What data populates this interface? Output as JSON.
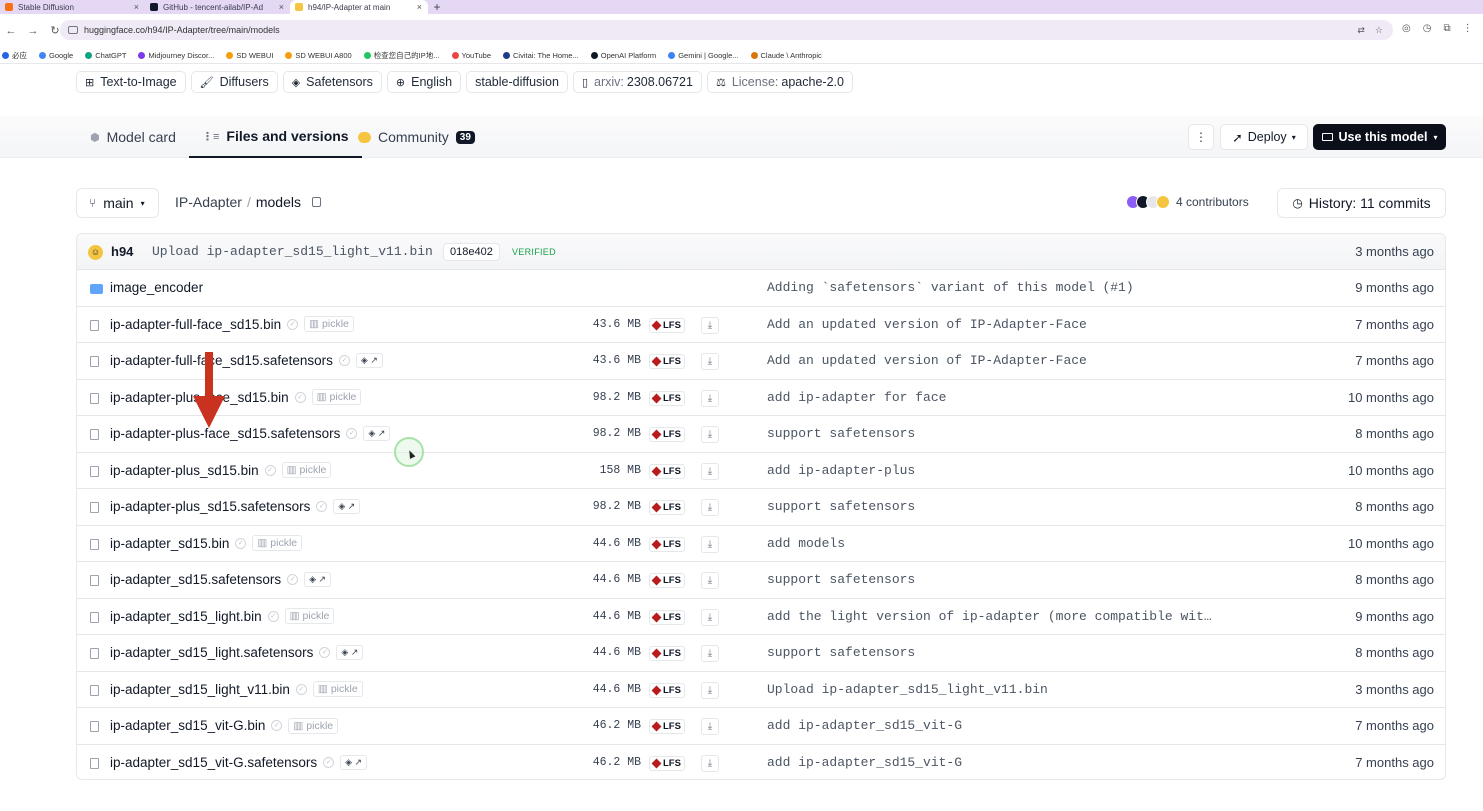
{
  "browser": {
    "tabs": [
      {
        "title": "Stable Diffusion",
        "icon_color": "#f97316"
      },
      {
        "title": "GitHub - tencent-ailab/IP-Ad",
        "icon_color": "#111827"
      },
      {
        "title": "h94/IP-Adapter at main",
        "icon_color": "#f5c542"
      }
    ],
    "new_tab": "+",
    "close_glyph": "×",
    "url": "huggingface.co/h94/IP-Adapter/tree/main/models",
    "bookmarks": [
      "必应",
      "Google",
      "ChatGPT",
      "Midjourney Discor...",
      "SD WEBUI",
      "SD WEBUI A800",
      "检查您自己的IP地...",
      "YouTube",
      "Civitai: The Home...",
      "OpenAI Platform",
      "Gemini | Google...",
      "Claude \\ Anthropic"
    ]
  },
  "tags": [
    {
      "icon": "text-to-image-icon",
      "glyph": "⊞",
      "label": "Text-to-Image"
    },
    {
      "icon": "diffusers-icon",
      "glyph": "🖌",
      "label": "Diffusers"
    },
    {
      "icon": "safetensors-icon",
      "glyph": "◈",
      "label": "Safetensors"
    },
    {
      "icon": "globe-icon",
      "glyph": "⊕",
      "label": "English"
    },
    {
      "icon": "",
      "glyph": "",
      "label": "stable-diffusion"
    },
    {
      "icon": "paper-icon",
      "glyph": "▯",
      "prefix": "arxiv:",
      "label": "2308.06721"
    },
    {
      "icon": "scale-icon",
      "glyph": "⚖",
      "prefix": "License:",
      "label": "apache-2.0"
    }
  ],
  "model_tabs": {
    "model_card": "Model card",
    "files": "Files and versions",
    "community": "Community",
    "community_count": "39"
  },
  "actions": {
    "kebab": "⋮",
    "deploy": "Deploy",
    "use_model": "Use this model"
  },
  "repo": {
    "branch": "main",
    "path_root": "IP-Adapter",
    "path_sep": "/",
    "path_dir": "models",
    "contributors": "4 contributors",
    "history": "History: 11 commits"
  },
  "last_commit": {
    "author": "h94",
    "message": "Upload ip-adapter_sd15_light_v11.bin",
    "hash": "018e402",
    "verified": "VERIFIED",
    "time": "3 months ago"
  },
  "files": [
    {
      "name": "image_encoder",
      "folder": true,
      "size": "",
      "commit": "Adding `safetensors` variant of this model (#1)",
      "time": "9 months ago"
    },
    {
      "name": "ip-adapter-full-face_sd15.bin",
      "kind": "pickle",
      "size": "43.6 MB",
      "commit": "Add an updated version of IP-Adapter-Face",
      "time": "7 months ago"
    },
    {
      "name": "ip-adapter-full-face_sd15.safetensors",
      "kind": "safetensors",
      "size": "43.6 MB",
      "commit": "Add an updated version of IP-Adapter-Face",
      "time": "7 months ago"
    },
    {
      "name": "ip-adapter-plus-face_sd15.bin",
      "kind": "pickle",
      "size": "98.2 MB",
      "commit": "add ip-adapter for face",
      "time": "10 months ago"
    },
    {
      "name": "ip-adapter-plus-face_sd15.safetensors",
      "kind": "safetensors",
      "size": "98.2 MB",
      "commit": "support safetensors",
      "time": "8 months ago"
    },
    {
      "name": "ip-adapter-plus_sd15.bin",
      "kind": "pickle",
      "size": "158 MB",
      "commit": "add ip-adapter-plus",
      "time": "10 months ago"
    },
    {
      "name": "ip-adapter-plus_sd15.safetensors",
      "kind": "safetensors",
      "size": "98.2 MB",
      "commit": "support safetensors",
      "time": "8 months ago"
    },
    {
      "name": "ip-adapter_sd15.bin",
      "kind": "pickle",
      "size": "44.6 MB",
      "commit": "add models",
      "time": "10 months ago"
    },
    {
      "name": "ip-adapter_sd15.safetensors",
      "kind": "safetensors",
      "size": "44.6 MB",
      "commit": "support safetensors",
      "time": "8 months ago"
    },
    {
      "name": "ip-adapter_sd15_light.bin",
      "kind": "pickle",
      "size": "44.6 MB",
      "commit": "add the light version of ip-adapter (more compatible wit…",
      "time": "9 months ago"
    },
    {
      "name": "ip-adapter_sd15_light.safetensors",
      "kind": "safetensors",
      "size": "44.6 MB",
      "commit": "support safetensors",
      "time": "8 months ago"
    },
    {
      "name": "ip-adapter_sd15_light_v11.bin",
      "kind": "pickle",
      "size": "44.6 MB",
      "commit": "Upload ip-adapter_sd15_light_v11.bin",
      "time": "3 months ago"
    },
    {
      "name": "ip-adapter_sd15_vit-G.bin",
      "kind": "pickle",
      "size": "46.2 MB",
      "commit": "add ip-adapter_sd15_vit-G",
      "time": "7 months ago"
    },
    {
      "name": "ip-adapter_sd15_vit-G.safetensors",
      "kind": "safetensors",
      "size": "46.2 MB",
      "commit": "add ip-adapter_sd15_vit-G",
      "time": "7 months ago"
    }
  ],
  "labels": {
    "pickle": "pickle",
    "lfs": "LFS",
    "safetensors_badge": "◈ ↗",
    "download_glyph": "⤓"
  },
  "colors": {
    "annotation_arrow": "#c8321e",
    "primary_button": "#0b0f19"
  }
}
